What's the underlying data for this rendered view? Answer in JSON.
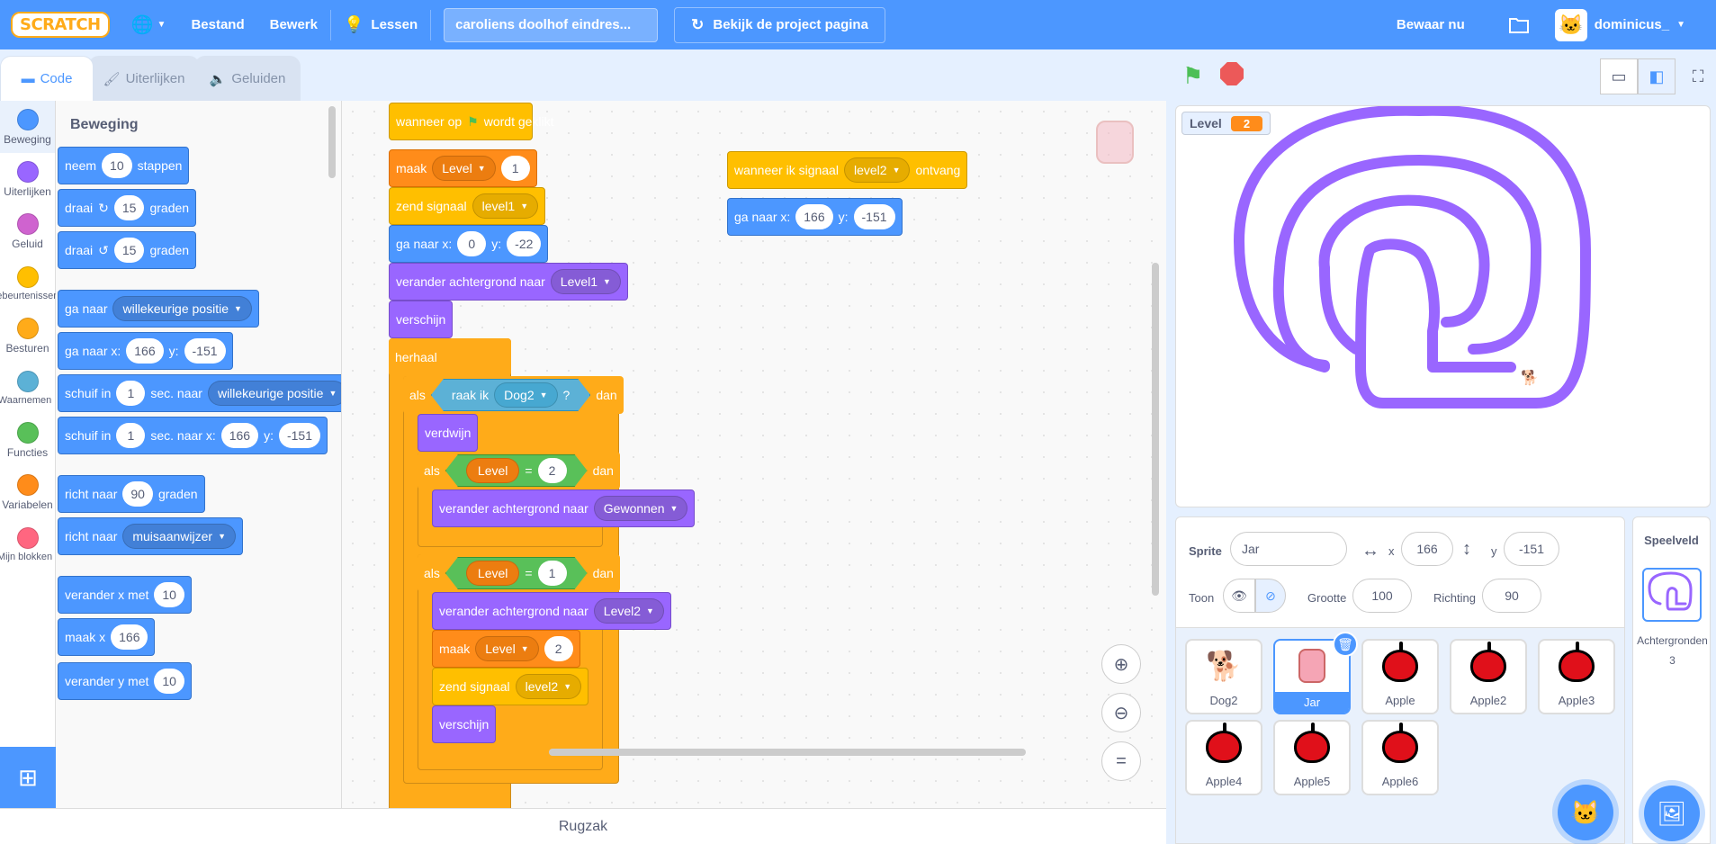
{
  "menubar": {
    "logo": "SCRATCH",
    "file": "Bestand",
    "edit": "Bewerk",
    "tutorials": "Lessen",
    "project_title": "caroliens doolhof eindres...",
    "see_project": "Bekijk de project pagina",
    "save_now": "Bewaar nu",
    "username": "dominicus_"
  },
  "tabs": {
    "code": "Code",
    "costumes": "Uiterlijken",
    "sounds": "Geluiden"
  },
  "categories": [
    {
      "label": "Beweging",
      "color": "#4c97ff"
    },
    {
      "label": "Uiterlijken",
      "color": "#9966ff"
    },
    {
      "label": "Geluid",
      "color": "#cf63cf"
    },
    {
      "label": "Gebeurtenissen",
      "color": "#ffbf00"
    },
    {
      "label": "Besturen",
      "color": "#ffab19"
    },
    {
      "label": "Waarnemen",
      "color": "#5cb1d6"
    },
    {
      "label": "Functies",
      "color": "#59c059"
    },
    {
      "label": "Variabelen",
      "color": "#ff8c1a"
    },
    {
      "label": "Mijn blokken",
      "color": "#ff6680"
    }
  ],
  "palette": {
    "title": "Beweging",
    "move": {
      "a": "neem",
      "v": "10",
      "b": "stappen"
    },
    "turn_cw": {
      "a": "draai",
      "v": "15",
      "b": "graden"
    },
    "turn_ccw": {
      "a": "draai",
      "v": "15",
      "b": "graden"
    },
    "goto": {
      "a": "ga naar",
      "d": "willekeurige positie"
    },
    "goto_xy": {
      "a": "ga naar x:",
      "x": "166",
      "b": "y:",
      "y": "-151"
    },
    "glide": {
      "a": "schuif in",
      "v": "1",
      "b": "sec. naar",
      "d": "willekeurige positie"
    },
    "glide_xy": {
      "a": "schuif in",
      "v": "1",
      "b": "sec. naar x:",
      "x": "166",
      "c": "y:",
      "y": "-151"
    },
    "point": {
      "a": "richt naar",
      "v": "90",
      "b": "graden"
    },
    "point_to": {
      "a": "richt naar",
      "d": "muisaanwijzer"
    },
    "change_x": {
      "a": "verander x met",
      "v": "10"
    },
    "set_x": {
      "a": "maak x",
      "v": "166"
    },
    "change_y": {
      "a": "verander y met",
      "v": "10"
    }
  },
  "script1": {
    "hat": {
      "a": "wanneer op",
      "b": "wordt geklikt"
    },
    "set_var": {
      "a": "maak",
      "d": "Level",
      "v": "1"
    },
    "broadcast": {
      "a": "zend signaal",
      "d": "level1"
    },
    "goto_xy": {
      "a": "ga naar x:",
      "x": "0",
      "b": "y:",
      "y": "-22"
    },
    "backdrop": {
      "a": "verander achtergrond naar",
      "d": "Level1"
    },
    "show": "verschijn",
    "forever": "herhaal",
    "if1": {
      "a": "als",
      "sense": "raak ik",
      "d": "Dog2",
      "q": "?",
      "b": "dan"
    },
    "hide": "verdwijn",
    "if2": {
      "a": "als",
      "var": "Level",
      "op": "=",
      "v": "2",
      "b": "dan"
    },
    "backdrop_won": {
      "a": "verander achtergrond naar",
      "d": "Gewonnen"
    },
    "if3": {
      "a": "als",
      "var": "Level",
      "op": "=",
      "v": "1",
      "b": "dan"
    },
    "backdrop_l2": {
      "a": "verander achtergrond naar",
      "d": "Level2"
    },
    "set_var2": {
      "a": "maak",
      "d": "Level",
      "v": "2"
    },
    "broadcast2": {
      "a": "zend signaal",
      "d": "level2"
    },
    "show2": "verschijn"
  },
  "script2": {
    "hat": {
      "a": "wanneer ik signaal",
      "d": "level2",
      "b": "ontvang"
    },
    "goto_xy": {
      "a": "ga naar x:",
      "x": "166",
      "b": "y:",
      "y": "-151"
    }
  },
  "backpack": "Rugzak",
  "stage": {
    "monitor_label": "Level",
    "monitor_value": "2"
  },
  "sprite_info": {
    "sprite_label": "Sprite",
    "sprite_name": "Jar",
    "x_label": "x",
    "x": "166",
    "y_label": "y",
    "y": "-151",
    "show_label": "Toon",
    "size_label": "Grootte",
    "size": "100",
    "direction_label": "Richting",
    "direction": "90"
  },
  "sprites": [
    "Dog2",
    "Jar",
    "Apple",
    "Apple2",
    "Apple3",
    "Apple4",
    "Apple5",
    "Apple6"
  ],
  "stage_panel": {
    "title": "Speelveld",
    "backdrops_label": "Achtergronden",
    "backdrops_count": "3"
  }
}
